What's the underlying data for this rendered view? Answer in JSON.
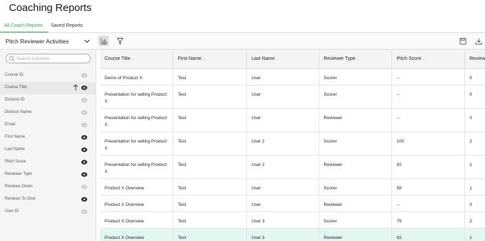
{
  "page_title": "Coaching Reports",
  "tabs": [
    {
      "label": "All Coach Reports",
      "active": true
    },
    {
      "label": "Saved Reports",
      "active": false
    }
  ],
  "dataset": {
    "selected": "Pitch Reviewer Activities"
  },
  "search": {
    "placeholder": "Search Columns"
  },
  "columns": [
    {
      "label": "Course ID",
      "visible": false
    },
    {
      "label": "Course Title",
      "visible": true,
      "sorted": "asc"
    },
    {
      "label": "Division ID",
      "visible": false
    },
    {
      "label": "Division Name",
      "visible": false
    },
    {
      "label": "Email",
      "visible": false
    },
    {
      "label": "First Name",
      "visible": true
    },
    {
      "label": "Last Name",
      "visible": true
    },
    {
      "label": "Pitch Score",
      "visible": true
    },
    {
      "label": "Reviewer Type",
      "visible": true
    },
    {
      "label": "Reviews Given",
      "visible": false
    },
    {
      "label": "Reviews To Give",
      "visible": true
    },
    {
      "label": "User ID",
      "visible": false
    }
  ],
  "toolbar": {
    "chart_icon": "bar-chart-icon",
    "filter_icon": "filter-icon",
    "save_icon": "save-icon",
    "download_icon": "download-icon"
  },
  "table": {
    "headers": [
      "Course Title",
      "First Name",
      "Last Name",
      "Reviewer Type",
      "Pitch Score",
      "Review"
    ],
    "rows": [
      [
        "Demo of Product X",
        "Test",
        "User",
        "Scorer",
        "--",
        "0"
      ],
      [
        "Presentation for selling Product X",
        "Test",
        "User",
        "Scorer",
        "--",
        "0"
      ],
      [
        "Presentation for selling Product X",
        "Test",
        "User",
        "Reviewer",
        "--",
        "0"
      ],
      [
        "Presentation for selling Product X",
        "Test",
        "User 2",
        "Scorer",
        "100",
        "2"
      ],
      [
        "Presentation for selling Product X",
        "Test",
        "User 2",
        "Reviewer",
        "92",
        "1"
      ],
      [
        "Product X Overview",
        "Test",
        "User",
        "Scorer",
        "58",
        "1"
      ],
      [
        "Product X Overview",
        "Test",
        "User",
        "Reviewer",
        "--",
        "0"
      ],
      [
        "Product X Overview",
        "Test",
        "User 3",
        "Scorer",
        "79",
        "2"
      ],
      [
        "Product X Overview",
        "Test",
        "User 3",
        "Reviewer",
        "92",
        "1"
      ]
    ],
    "selected_row": 8
  },
  "colors": {
    "accent": "#3aa15b",
    "selected_row": "#e4f6f2"
  }
}
